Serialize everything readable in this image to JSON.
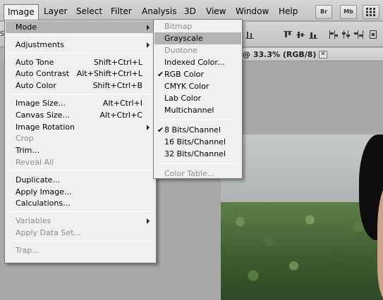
{
  "menubar": {
    "items": [
      "Image",
      "Layer",
      "Select",
      "Filter",
      "Analysis",
      "3D",
      "View",
      "Window",
      "Help"
    ],
    "open_item": "Image",
    "app_buttons": [
      "Br",
      "Mb"
    ]
  },
  "optionsbar": {
    "stub": "Sc"
  },
  "document_tab": {
    "title": "@ 33.3% (RGB/8)",
    "close_icon": "close-icon"
  },
  "image_menu": {
    "items": [
      {
        "label": "Mode",
        "shortcut": "",
        "submenu": true,
        "disabled": false,
        "highlighted": true
      },
      {
        "separator": true
      },
      {
        "label": "Adjustments",
        "shortcut": "",
        "submenu": true,
        "disabled": false
      },
      {
        "separator": true
      },
      {
        "label": "Auto Tone",
        "shortcut": "Shift+Ctrl+L",
        "disabled": false
      },
      {
        "label": "Auto Contrast",
        "shortcut": "Alt+Shift+Ctrl+L",
        "disabled": false
      },
      {
        "label": "Auto Color",
        "shortcut": "Shift+Ctrl+B",
        "disabled": false
      },
      {
        "separator": true
      },
      {
        "label": "Image Size...",
        "shortcut": "Alt+Ctrl+I",
        "disabled": false
      },
      {
        "label": "Canvas Size...",
        "shortcut": "Alt+Ctrl+C",
        "disabled": false
      },
      {
        "label": "Image Rotation",
        "shortcut": "",
        "submenu": true,
        "disabled": false
      },
      {
        "label": "Crop",
        "shortcut": "",
        "disabled": true
      },
      {
        "label": "Trim...",
        "shortcut": "",
        "disabled": false
      },
      {
        "label": "Reveal All",
        "shortcut": "",
        "disabled": true
      },
      {
        "separator": true
      },
      {
        "label": "Duplicate...",
        "shortcut": "",
        "disabled": false
      },
      {
        "label": "Apply Image...",
        "shortcut": "",
        "disabled": false
      },
      {
        "label": "Calculations...",
        "shortcut": "",
        "disabled": false
      },
      {
        "separator": true
      },
      {
        "label": "Variables",
        "shortcut": "",
        "submenu": true,
        "disabled": true
      },
      {
        "label": "Apply Data Set...",
        "shortcut": "",
        "disabled": true
      },
      {
        "separator": true
      },
      {
        "label": "Trap...",
        "shortcut": "",
        "disabled": true
      }
    ]
  },
  "mode_submenu": {
    "items": [
      {
        "label": "Bitmap",
        "disabled": true
      },
      {
        "label": "Grayscale",
        "disabled": false,
        "highlighted": true
      },
      {
        "label": "Duotone",
        "disabled": true
      },
      {
        "label": "Indexed Color...",
        "disabled": false
      },
      {
        "label": "RGB Color",
        "disabled": false,
        "checked": true
      },
      {
        "label": "CMYK Color",
        "disabled": false
      },
      {
        "label": "Lab Color",
        "disabled": false
      },
      {
        "label": "Multichannel",
        "disabled": false
      },
      {
        "separator": true
      },
      {
        "label": "8 Bits/Channel",
        "disabled": false,
        "checked": true
      },
      {
        "label": "16 Bits/Channel",
        "disabled": false
      },
      {
        "label": "32 Bits/Channel",
        "disabled": false
      },
      {
        "separator": true
      },
      {
        "label": "Color Table...",
        "disabled": true
      }
    ]
  },
  "colors": {
    "menu_bg": "#f0f0f0",
    "highlight": "#b3b3b3",
    "disabled_text": "#8d8d8d",
    "workspace": "#adadad"
  }
}
